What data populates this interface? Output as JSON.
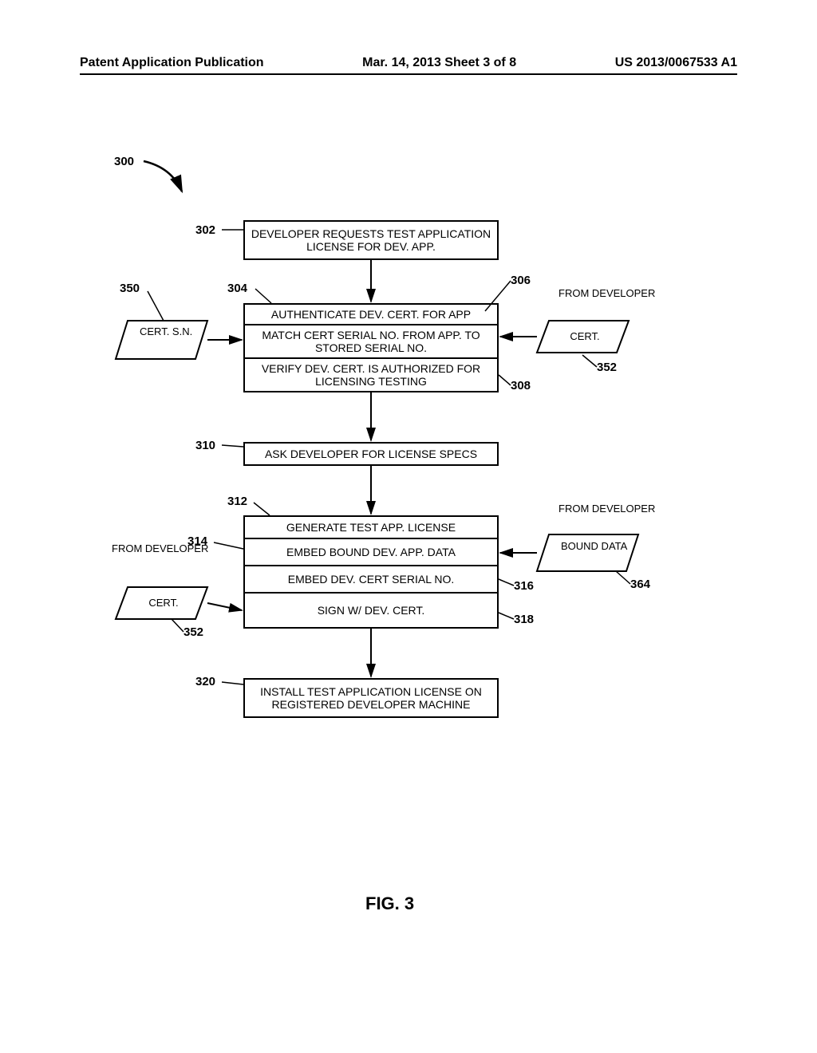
{
  "header": {
    "left": "Patent Application Publication",
    "center": "Mar. 14, 2013  Sheet 3 of 8",
    "right": "US 2013/0067533 A1"
  },
  "refs": {
    "r300": "300",
    "r302": "302",
    "r304": "304",
    "r306": "306",
    "r308": "308",
    "r310": "310",
    "r312": "312",
    "r314": "314",
    "r316": "316",
    "r318": "318",
    "r320": "320",
    "r350": "350",
    "r352a": "352",
    "r352b": "352",
    "r364": "364"
  },
  "boxes": {
    "b302": "DEVELOPER REQUESTS TEST APPLICATION LICENSE FOR DEV. APP.",
    "b304": "AUTHENTICATE DEV. CERT. FOR APP",
    "b306": "MATCH CERT SERIAL NO. FROM APP. TO STORED SERIAL NO.",
    "b308": "VERIFY DEV. CERT. IS AUTHORIZED FOR LICENSING TESTING",
    "b310": "ASK DEVELOPER FOR LICENSE SPECS",
    "b312": "GENERATE TEST APP. LICENSE",
    "b314": "EMBED BOUND DEV. APP. DATA",
    "b316": "EMBED DEV. CERT SERIAL NO.",
    "b318": "SIGN W/ DEV. CERT.",
    "b320": "INSTALL TEST APPLICATION LICENSE ON REGISTERED DEVELOPER MACHINE"
  },
  "paras": {
    "p350": "CERT. S.N.",
    "p352a": "CERT.",
    "p352b": "CERT.",
    "p364": "BOUND DATA"
  },
  "annot": {
    "fromdev1": "FROM DEVELOPER",
    "fromdev2": "FROM DEVELOPER",
    "fromdev3": "FROM DEVELOPER"
  },
  "figure": "FIG. 3"
}
